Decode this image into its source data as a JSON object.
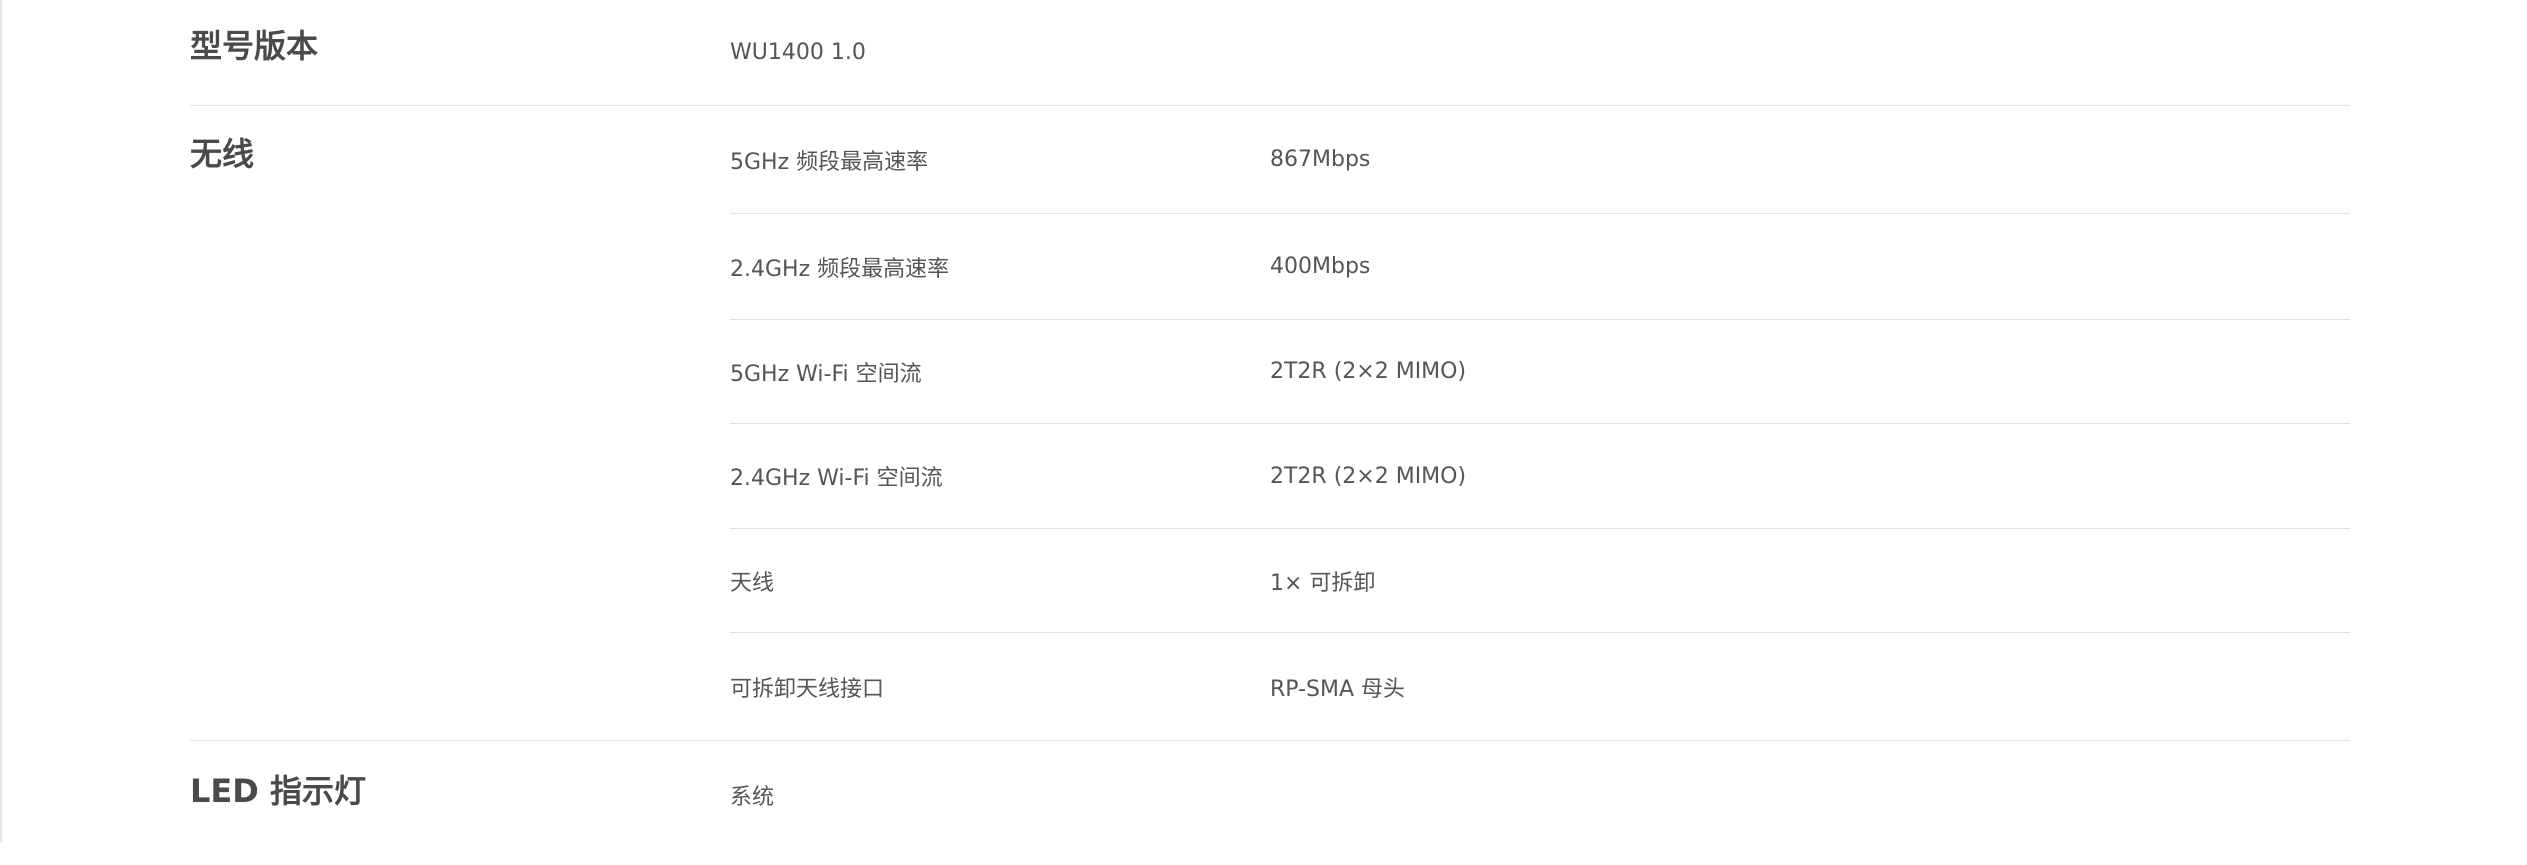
{
  "sections": [
    {
      "title": "型号版本",
      "rows": [
        {
          "label": "WU1400 1.0",
          "value": ""
        }
      ]
    },
    {
      "title": "无线",
      "rows": [
        {
          "label": "5GHz 频段最高速率",
          "value": "867Mbps"
        },
        {
          "label": "2.4GHz 频段最高速率",
          "value": "400Mbps"
        },
        {
          "label": "5GHz Wi-Fi 空间流",
          "value": "2T2R (2×2 MIMO)"
        },
        {
          "label": "2.4GHz Wi-Fi 空间流",
          "value": "2T2R (2×2 MIMO)"
        },
        {
          "label": "天线",
          "value": "1× 可拆卸"
        },
        {
          "label": "可拆卸天线接口",
          "value": "RP-SMA 母头"
        }
      ]
    },
    {
      "title": "LED 指示灯",
      "rows": [
        {
          "label": "系统",
          "value": ""
        }
      ]
    }
  ]
}
